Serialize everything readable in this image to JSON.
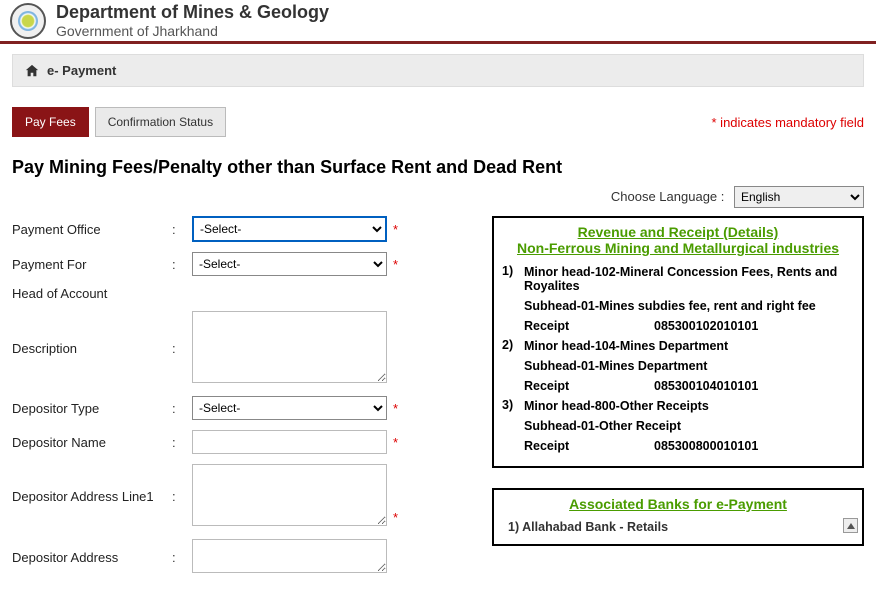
{
  "header": {
    "dept_title": "Department of Mines & Geology",
    "dept_subtitle": "Government of Jharkhand"
  },
  "breadcrumb": {
    "text": "e- Payment"
  },
  "tabs": {
    "pay_fees": "Pay Fees",
    "confirmation_status": "Confirmation Status"
  },
  "mandatory_text": "* indicates mandatory field",
  "page_heading": "Pay Mining Fees/Penalty other than Surface Rent and Dead Rent",
  "language": {
    "label": "Choose Language :",
    "selected": "English"
  },
  "form": {
    "payment_office_label": "Payment Office",
    "payment_office_value": "-Select-",
    "payment_for_label": "Payment For",
    "payment_for_value": "-Select-",
    "head_of_account_label": "Head of Account",
    "description_label": "Description",
    "depositor_type_label": "Depositor Type",
    "depositor_type_value": "-Select-",
    "depositor_name_label": "Depositor Name",
    "depositor_address1_label": "Depositor Address Line1",
    "depositor_address2_label": "Depositor Address"
  },
  "revenue_panel": {
    "title": "Revenue and Receipt (Details)",
    "subtitle": "Non-Ferrous Mining and Metallurgical industries",
    "receipt_label": "Receipt",
    "items": [
      {
        "num": "1)",
        "minor": "Minor head-102-Mineral Concession Fees, Rents and Royalites",
        "subhead": "Subhead-01-Mines subdies fee, rent and right fee",
        "receipt": "085300102010101"
      },
      {
        "num": "2)",
        "minor": "Minor head-104-Mines Department",
        "subhead": "Subhead-01-Mines Department",
        "receipt": "085300104010101"
      },
      {
        "num": "3)",
        "minor": "Minor head-800-Other Receipts",
        "subhead": "Subhead-01-Other Receipt",
        "receipt": "085300800010101"
      }
    ]
  },
  "banks_panel": {
    "title": "Associated Banks for e-Payment",
    "items": [
      {
        "num": "1)",
        "name": "Allahabad Bank - Retails"
      }
    ]
  }
}
